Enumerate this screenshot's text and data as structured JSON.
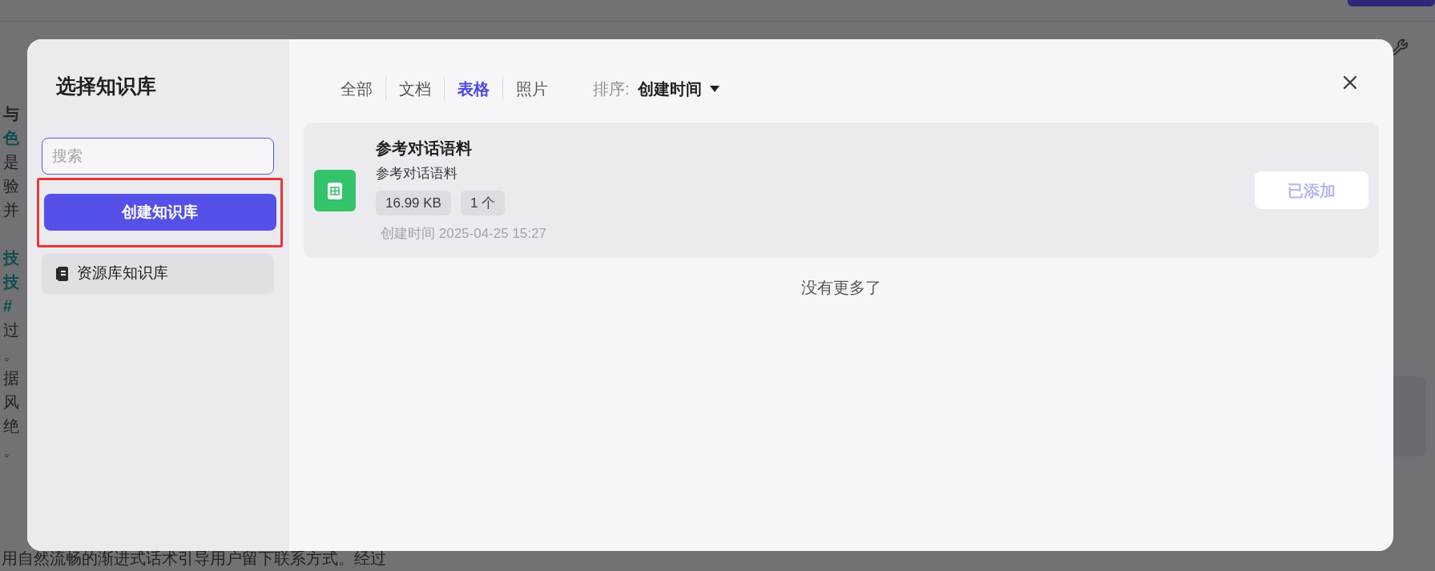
{
  "background": {
    "lines": [
      {
        "text": "与",
        "kind": "heading"
      },
      {
        "text": "色",
        "kind": "accent"
      },
      {
        "text": "是",
        "kind": "plain"
      },
      {
        "text": "验",
        "kind": "plain"
      },
      {
        "text": "并",
        "kind": "plain"
      },
      {
        "kind": "gap"
      },
      {
        "text": "技",
        "kind": "accent"
      },
      {
        "text": "技",
        "kind": "accent"
      },
      {
        "text": "#",
        "kind": "accent"
      },
      {
        "text": "过",
        "kind": "plain"
      },
      {
        "text": "。",
        "kind": "plain"
      },
      {
        "text": "据",
        "kind": "plain"
      },
      {
        "text": "风",
        "kind": "plain"
      },
      {
        "text": "绝",
        "kind": "plain"
      },
      {
        "text": "。",
        "kind": "plain"
      }
    ],
    "bottom_line": "用自然流畅的渐进式话术引导用户留下联系方式。经过"
  },
  "dialog": {
    "title": "选择知识库",
    "search": {
      "placeholder": "搜索"
    },
    "create_button": "创建知识库",
    "knowledge_bases": [
      {
        "label": "资源库知识库",
        "selected": true
      }
    ],
    "tabs": [
      {
        "label": "全部",
        "selected": false
      },
      {
        "label": "文档",
        "selected": false
      },
      {
        "label": "表格",
        "selected": true
      },
      {
        "label": "照片",
        "selected": false
      }
    ],
    "sort": {
      "label": "排序:",
      "value": "创建时间"
    },
    "items": [
      {
        "title": "参考对话语料",
        "description": "参考对话语料",
        "size": "16.99 KB",
        "count": "1 个",
        "created": "创建时间 2025-04-25 15:27",
        "added": true,
        "action": "已添加"
      }
    ],
    "end_text": "没有更多了"
  }
}
